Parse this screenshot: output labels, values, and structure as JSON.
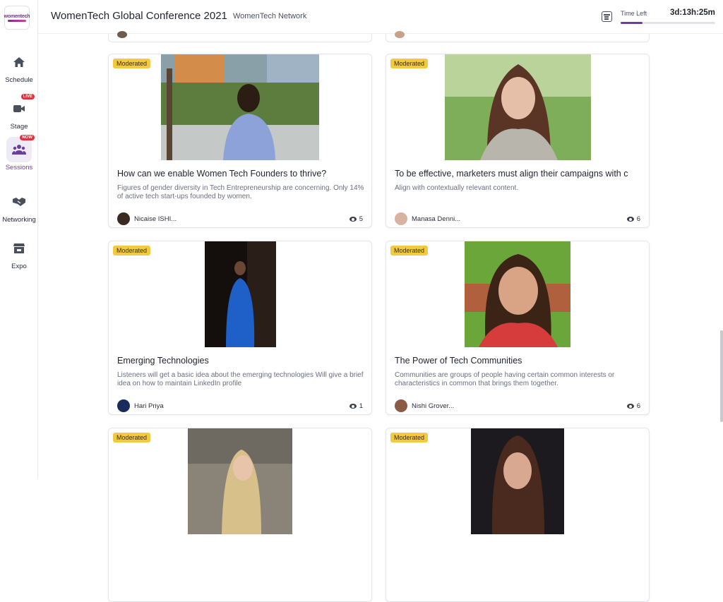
{
  "app": {
    "logo_text": "womentech",
    "title": "WomenTech Global Conference 2021",
    "network": "WomenTech Network"
  },
  "timer": {
    "label": "Time Left",
    "value": "3d:13h:25m",
    "progress": 0.23
  },
  "sidebar": {
    "items": [
      {
        "label": "Schedule",
        "icon": "home-icon"
      },
      {
        "label": "Stage",
        "icon": "video-camera-icon",
        "badge": "LIVE"
      },
      {
        "label": "Sessions",
        "icon": "people-group-icon",
        "badge": "NOW",
        "active": true
      },
      {
        "label": "Networking",
        "icon": "handshake-icon"
      },
      {
        "label": "Expo",
        "icon": "store-icon"
      }
    ]
  },
  "colors": {
    "accent": "#6b3fa0",
    "tag_bg": "#f3c942",
    "badge_bg": "#e0323c"
  },
  "sessions": [
    {
      "tag": "Moderated",
      "title": "How can we enable Women Tech Founders to thrive?",
      "description": "Figures of gender diversity in Tech Entrepreneurship are concerning. Only 14% of active tech start-ups founded by women.",
      "speaker": "Nicaise ISHI...",
      "views": "5"
    },
    {
      "tag": "Moderated",
      "title": "To be effective, marketers must align their campaigns with c",
      "description": "Align with contextually relevant content.",
      "speaker": "Manasa Denni...",
      "views": "6"
    },
    {
      "tag": "Moderated",
      "title": "Emerging Technologies",
      "description": "Listeners will get a basic idea about the emerging technologies Will give a brief idea on how to maintain LinkedIn profile",
      "speaker": "Hari Priya",
      "views": "1"
    },
    {
      "tag": "Moderated",
      "title": "The Power of Tech Communities",
      "description": "Communities are groups of people having certain common interests or characteristics in common that brings them together.",
      "speaker": "Nishi Grover...",
      "views": "6"
    },
    {
      "tag": "Moderated"
    },
    {
      "tag": "Moderated"
    }
  ]
}
